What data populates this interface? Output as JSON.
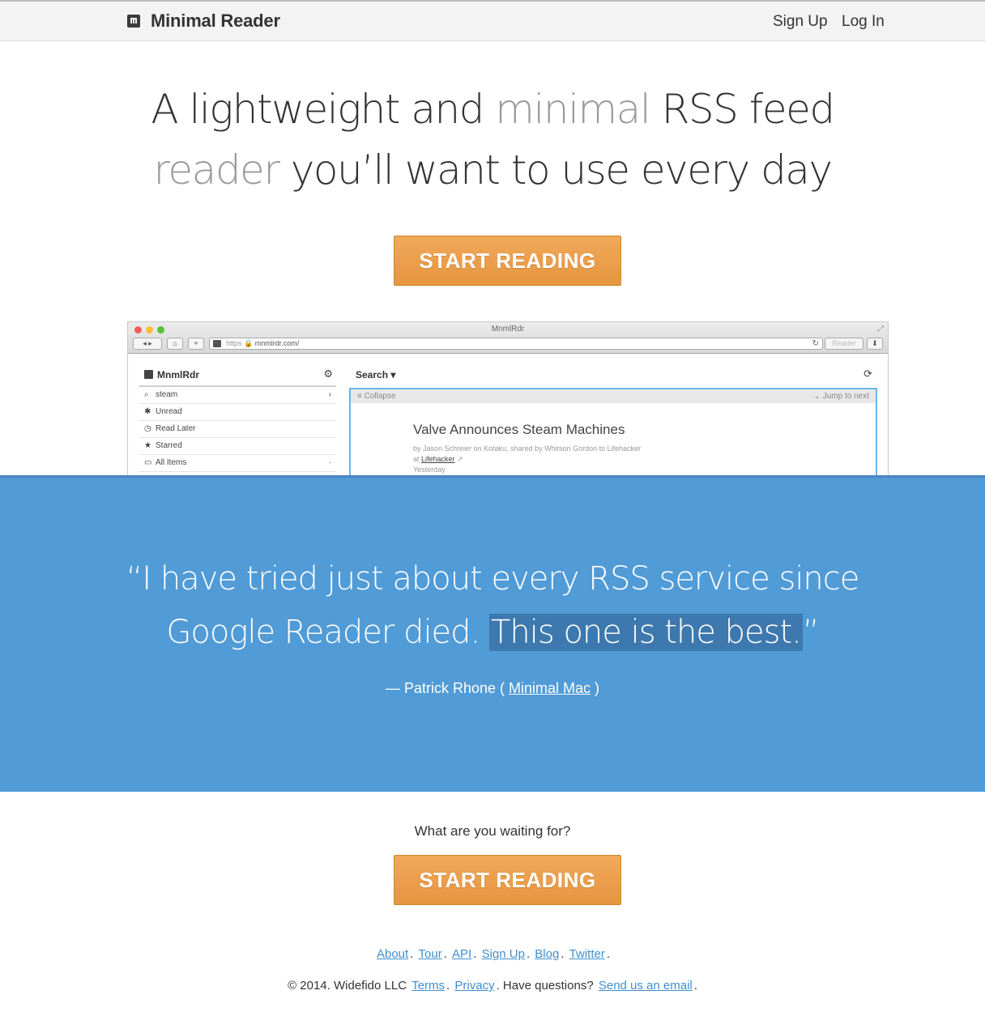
{
  "nav": {
    "brand": "Minimal Reader",
    "signup": "Sign Up",
    "login": "Log In"
  },
  "hero": {
    "line1_a": "A lightweight and ",
    "line1_b": "minimal",
    "line1_c": " RSS feed",
    "line2_a": "reader",
    "line2_b": " you’ll want to use every day",
    "cta": "START READING"
  },
  "screenshot": {
    "window_title": "MnmlRdr",
    "url_scheme": "https",
    "url": "mnmlrdr.com/",
    "reader_btn": "Reader",
    "sidebar_title": "MnmlRdr",
    "sidebar_items": [
      "steam",
      "Unread",
      "Read Later",
      "Starred",
      "All Items"
    ],
    "search_label": "Search",
    "collapse_label": "Collapse",
    "jump_label": "Jump to next",
    "article_title": "Valve Announces Steam Machines",
    "article_byline": "by Jason Schreier on Kotaku, shared by Whitson Gordon to Lifehacker",
    "article_at": "at ",
    "article_source": "Lifehacker",
    "article_date": "Yesterday"
  },
  "quote": {
    "text_a": "“I have tried just about every RSS service since",
    "text_b": "Google Reader died. ",
    "text_hl": "This one is the best.",
    "text_end": "”",
    "attrib_prefix": "— Patrick Rhone ( ",
    "attrib_link": "Minimal Mac",
    "attrib_suffix": " )"
  },
  "footer": {
    "waiting": "What are you waiting for?",
    "cta": "START READING",
    "links": [
      "About",
      "Tour",
      "API",
      "Sign Up",
      "Blog",
      "Twitter"
    ],
    "copyright": "© 2014. Widefido LLC",
    "terms": "Terms",
    "privacy": "Privacy",
    "questions": "Have questions?",
    "email": "Send us an email"
  },
  "colors": {
    "accent": "#e8993f",
    "quote_band": "#519bd7",
    "link": "#3f8fd0"
  }
}
